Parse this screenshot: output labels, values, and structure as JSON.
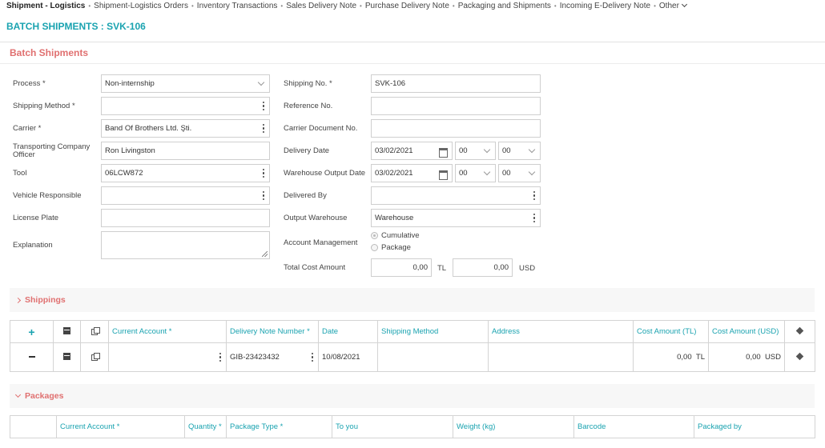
{
  "nav": {
    "items": [
      {
        "label": "Shipment - Logistics",
        "active": true
      },
      {
        "label": "Shipment-Logistics Orders"
      },
      {
        "label": "Inventory Transactions"
      },
      {
        "label": "Sales Delivery Note"
      },
      {
        "label": "Purchase Delivery Note"
      },
      {
        "label": "Packaging and Shipments"
      },
      {
        "label": "Incoming E-Delivery Note"
      }
    ],
    "other": "Other"
  },
  "page_title": "BATCH SHIPMENTS : SVK-106",
  "section_title": "Batch Shipments",
  "form": {
    "process": {
      "label": "Process *",
      "value": "Non-internship"
    },
    "shipping_method": {
      "label": "Shipping Method *",
      "value": ""
    },
    "carrier": {
      "label": "Carrier *",
      "value": "Band Of Brothers Ltd. Şti."
    },
    "transport_officer": {
      "label": "Transporting Company Officer",
      "value": "Ron Livingston"
    },
    "tool": {
      "label": "Tool",
      "value": "06LCW872"
    },
    "vehicle_responsible": {
      "label": "Vehicle Responsible",
      "value": ""
    },
    "license_plate": {
      "label": "License Plate",
      "value": ""
    },
    "explanation": {
      "label": "Explanation",
      "value": ""
    },
    "shipping_no": {
      "label": "Shipping No. *",
      "value": "SVK-106"
    },
    "reference_no": {
      "label": "Reference No.",
      "value": ""
    },
    "carrier_doc_no": {
      "label": "Carrier Document No.",
      "value": ""
    },
    "delivery_date": {
      "label": "Delivery Date",
      "value": "03/02/2021",
      "hour": "00",
      "minute": "00"
    },
    "warehouse_output_date": {
      "label": "Warehouse Output Date",
      "value": "03/02/2021",
      "hour": "00",
      "minute": "00"
    },
    "delivered_by": {
      "label": "Delivered By",
      "value": ""
    },
    "output_warehouse": {
      "label": "Output Warehouse",
      "value": "Warehouse"
    },
    "account_management": {
      "label": "Account Management",
      "options": [
        "Cumulative",
        "Package"
      ],
      "selected": "Cumulative"
    },
    "total_cost": {
      "label": "Total Cost Amount",
      "tl_value": "0,00",
      "tl_unit": "TL",
      "usd_value": "0,00",
      "usd_unit": "USD"
    }
  },
  "shippings": {
    "title": "Shippings",
    "headers": [
      "Current Account *",
      "Delivery Note Number *",
      "Date",
      "Shipping Method",
      "Address",
      "Cost Amount (TL)",
      "Cost Amount (USD)"
    ],
    "rows": [
      {
        "current_account": "",
        "delivery_note": "GIB-23423432",
        "date": "10/08/2021",
        "shipping_method": "",
        "address": "",
        "cost_tl": "0,00",
        "tl_unit": "TL",
        "cost_usd": "0,00",
        "usd_unit": "USD"
      }
    ]
  },
  "packages": {
    "title": "Packages",
    "headers": [
      "Current Account *",
      "Quantity *",
      "Package Type *",
      "To you",
      "Weight (kg)",
      "Barcode",
      "Packaged by"
    ]
  },
  "add_glyph": "+"
}
